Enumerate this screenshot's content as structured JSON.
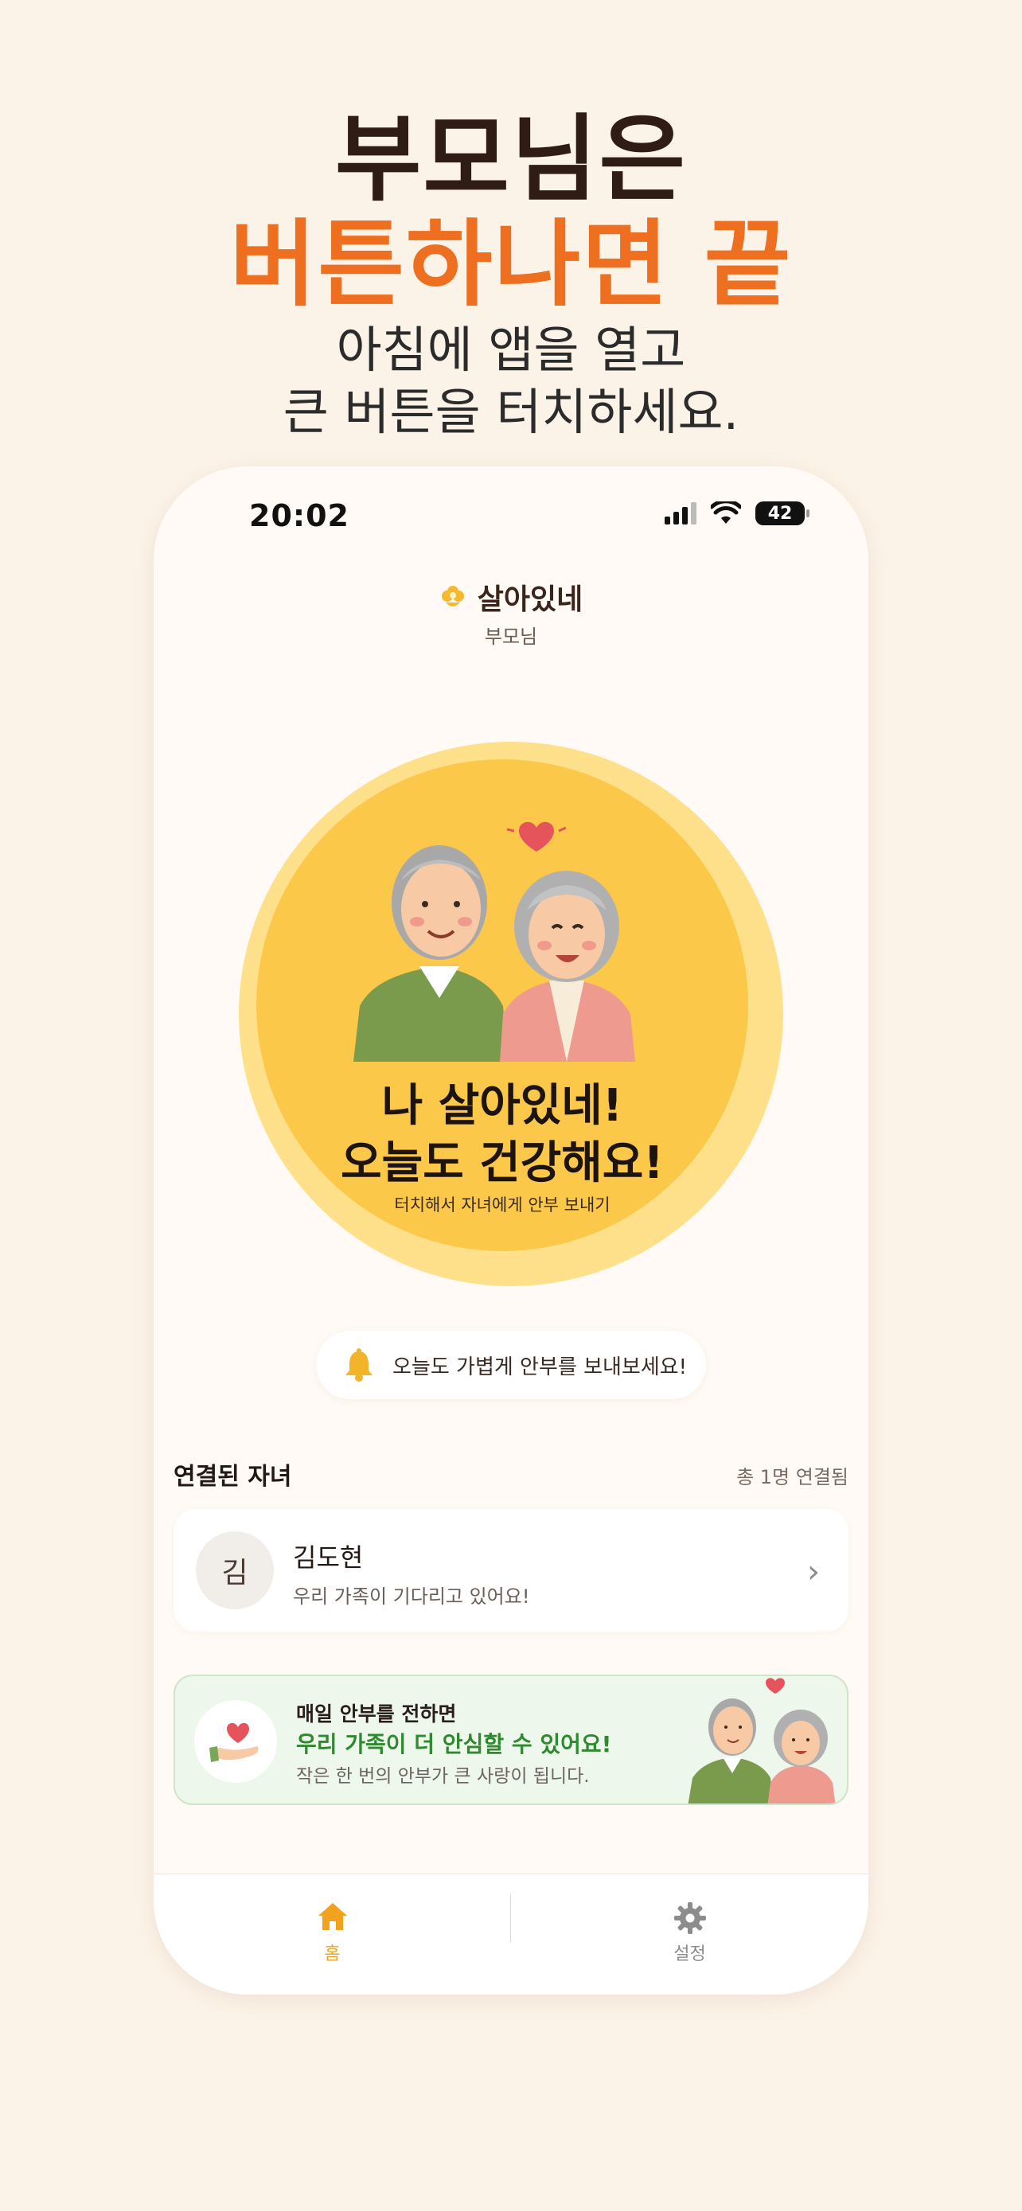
{
  "header": {
    "line1": "부모님은",
    "line2": "버튼하나면 끝",
    "sub1": "아침에 앱을 열고",
    "sub2": "큰 버튼을 터치하세요."
  },
  "status_bar": {
    "time": "20:02",
    "battery": "42"
  },
  "app": {
    "name": "살아있네",
    "role": "부모님"
  },
  "main_button": {
    "line1": "나 살아있네!",
    "line2": "오늘도 건강해요!",
    "hint": "터치해서 자녀에게 안부 보내기"
  },
  "reminder": {
    "text": "오늘도 가볍게 안부를 보내보세요!"
  },
  "connected": {
    "title": "연결된 자녀",
    "count": "총 1명 연결됨",
    "children": [
      {
        "initial": "김",
        "name": "김도현",
        "message": "우리 가족이 기다리고 있어요!"
      }
    ]
  },
  "promo": {
    "line1": "매일 안부를 전하면",
    "line2": "우리 가족이 더 안심할 수 있어요!",
    "line3": "작은 한 번의 안부가 큰 사랑이 됩니다."
  },
  "tabs": {
    "home": "홈",
    "settings": "설정"
  },
  "colors": {
    "accent_orange": "#ee6f1f",
    "button_yellow": "#fcc84a",
    "tab_active": "#f2a21c",
    "promo_green": "#2f8a2f"
  }
}
